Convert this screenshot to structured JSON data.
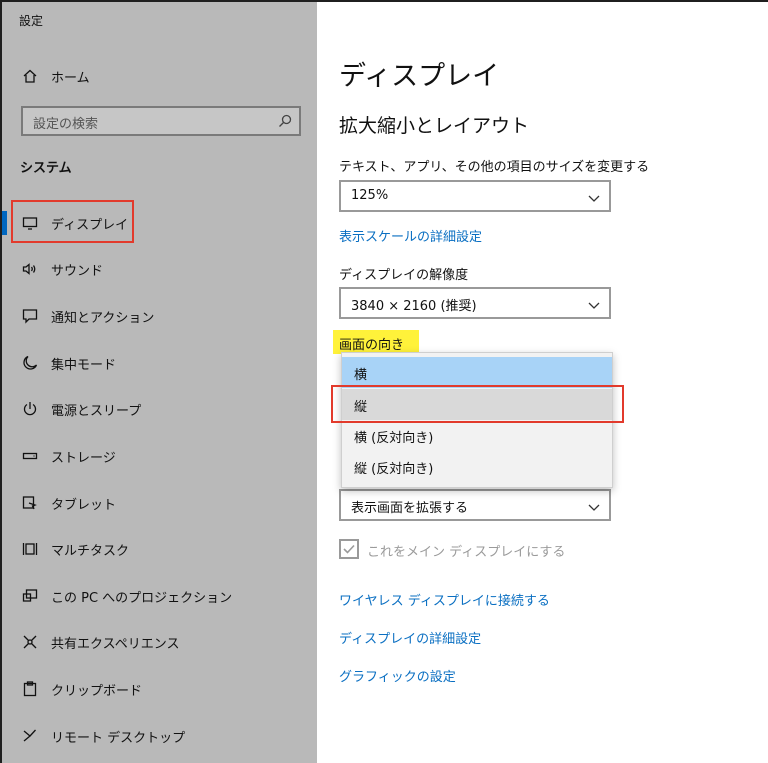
{
  "window": {
    "title": "設定"
  },
  "sidebar": {
    "home_label": "ホーム",
    "search_placeholder": "設定の検索",
    "section_label": "システム",
    "items": [
      {
        "label": "ディスプレイ",
        "icon": "monitor-icon",
        "selected": true
      },
      {
        "label": "サウンド",
        "icon": "speaker-icon"
      },
      {
        "label": "通知とアクション",
        "icon": "notification-icon"
      },
      {
        "label": "集中モード",
        "icon": "moon-icon"
      },
      {
        "label": "電源とスリープ",
        "icon": "power-icon"
      },
      {
        "label": "ストレージ",
        "icon": "storage-icon"
      },
      {
        "label": "タブレット",
        "icon": "tablet-icon"
      },
      {
        "label": "マルチタスク",
        "icon": "multitask-icon"
      },
      {
        "label": "この PC へのプロジェクション",
        "icon": "projection-icon"
      },
      {
        "label": "共有エクスペリエンス",
        "icon": "share-icon"
      },
      {
        "label": "クリップボード",
        "icon": "clipboard-icon"
      },
      {
        "label": "リモート デスクトップ",
        "icon": "remote-desktop-icon"
      }
    ]
  },
  "main": {
    "page_title": "ディスプレイ",
    "section_title": "拡大縮小とレイアウト",
    "scale_label": "テキスト、アプリ、その他の項目のサイズを変更する",
    "scale_value": "125%",
    "advanced_scale_link": "表示スケールの詳細設定",
    "resolution_label": "ディスプレイの解像度",
    "resolution_value": "3840 × 2160 (推奨)",
    "orientation_label": "画面の向き",
    "orientation_options": [
      "横",
      "縦",
      "横 (反対向き)",
      "縦 (反対向き)"
    ],
    "orientation_selected": "横",
    "orientation_hover": "縦",
    "multi_display_value": "表示画面を拡張する",
    "main_display_checkbox": "これをメイン ディスプレイにする",
    "links": {
      "wireless": "ワイヤレス ディスプレイに接続する",
      "advanced_display": "ディスプレイの詳細設定",
      "graphics": "グラフィックの設定"
    }
  },
  "colors": {
    "accent": "#0067c0",
    "link": "#0a6fc2",
    "highlight_red": "#e23a2c",
    "highlight_yellow": "#fff23a",
    "selected_option": "#a8d3f7"
  }
}
